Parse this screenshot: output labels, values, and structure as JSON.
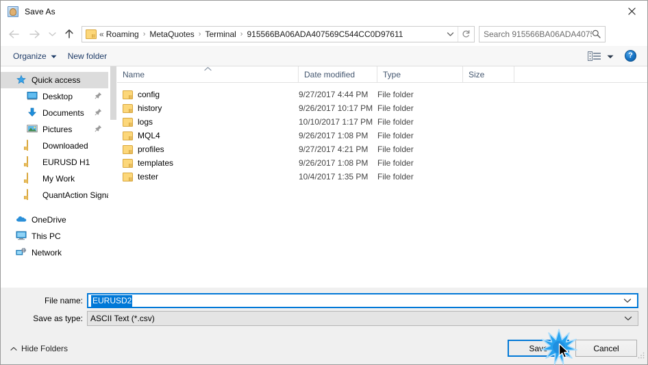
{
  "window": {
    "title": "Save As",
    "icon": "save-as-icon",
    "close_label": "✕"
  },
  "nav": {
    "back": "back-arrow",
    "forward": "forward-arrow",
    "recent": "recent-locations-chevron",
    "up": "up-arrow",
    "address": {
      "prefix": "«",
      "crumbs": [
        "Roaming",
        "MetaQuotes",
        "Terminal",
        "915566BA06ADA407569C544CC0D97611"
      ],
      "separator": "›",
      "dropdown": "address-dropdown-chevron",
      "refresh": "refresh-icon"
    },
    "search": {
      "placeholder": "Search 915566BA06ADA40756...",
      "value": "",
      "icon": "search-icon"
    }
  },
  "toolbar": {
    "organize": "Organize",
    "organize_caret": "▾",
    "new_folder": "New folder",
    "view_icon": "view-layout-icon",
    "view_caret": "▾",
    "help": "?"
  },
  "sidebar": {
    "items": [
      {
        "label": "Quick access",
        "icon": "star-pin-icon",
        "selected": true,
        "pinned": false,
        "indent": false
      },
      {
        "label": "Desktop",
        "icon": "desktop-icon",
        "selected": false,
        "pinned": true,
        "indent": true
      },
      {
        "label": "Documents",
        "icon": "documents-icon",
        "selected": false,
        "pinned": true,
        "indent": true
      },
      {
        "label": "Pictures",
        "icon": "pictures-icon",
        "selected": false,
        "pinned": true,
        "indent": true
      },
      {
        "label": "Downloaded",
        "icon": "folder-icon",
        "selected": false,
        "pinned": false,
        "indent": true
      },
      {
        "label": "EURUSD H1",
        "icon": "folder-icon",
        "selected": false,
        "pinned": false,
        "indent": true
      },
      {
        "label": "My Work",
        "icon": "folder-icon",
        "selected": false,
        "pinned": false,
        "indent": true
      },
      {
        "label": "QuantAction Signal",
        "icon": "folder-icon",
        "selected": false,
        "pinned": false,
        "indent": true
      },
      {
        "label": "OneDrive",
        "icon": "onedrive-icon",
        "selected": false,
        "pinned": false,
        "indent": false
      },
      {
        "label": "This PC",
        "icon": "this-pc-icon",
        "selected": false,
        "pinned": false,
        "indent": false
      },
      {
        "label": "Network",
        "icon": "network-icon",
        "selected": false,
        "pinned": false,
        "indent": false
      }
    ]
  },
  "filelist": {
    "columns": [
      "Name",
      "Date modified",
      "Type",
      "Size"
    ],
    "sort": {
      "column": "Name",
      "direction": "ascending",
      "caret": "⌃"
    },
    "rows": [
      {
        "name": "config",
        "date": "9/27/2017 4:44 PM",
        "type": "File folder",
        "size": ""
      },
      {
        "name": "history",
        "date": "9/26/2017 10:17 PM",
        "type": "File folder",
        "size": ""
      },
      {
        "name": "logs",
        "date": "10/10/2017 1:17 PM",
        "type": "File folder",
        "size": ""
      },
      {
        "name": "MQL4",
        "date": "9/26/2017 1:08 PM",
        "type": "File folder",
        "size": ""
      },
      {
        "name": "profiles",
        "date": "9/27/2017 4:21 PM",
        "type": "File folder",
        "size": ""
      },
      {
        "name": "templates",
        "date": "9/26/2017 1:08 PM",
        "type": "File folder",
        "size": ""
      },
      {
        "name": "tester",
        "date": "10/4/2017 1:35 PM",
        "type": "File folder",
        "size": ""
      }
    ]
  },
  "form": {
    "filename_label": "File name:",
    "filename_value": "EURUSD2",
    "filetype_label": "Save as type:",
    "filetype_value": "ASCII Text (*.csv)"
  },
  "footer": {
    "hide_folders": "Hide Folders",
    "hide_caret": "⌃",
    "save": "Save",
    "cancel": "Cancel"
  },
  "colors": {
    "accent": "#0078d7",
    "folder": "#fcd77a",
    "toolbar_text": "#1f3c68",
    "header_text": "#42556e",
    "help_blue": "#1673c4"
  }
}
